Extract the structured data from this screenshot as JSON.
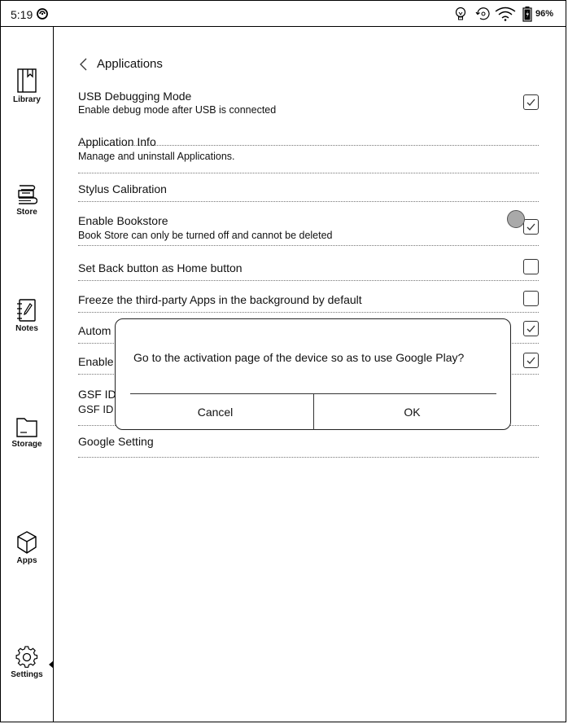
{
  "status": {
    "time": "5:19",
    "battery_percent": "96%"
  },
  "nav": {
    "library": "Library",
    "store": "Store",
    "notes": "Notes",
    "storage": "Storage",
    "apps": "Apps",
    "settings": "Settings"
  },
  "page": {
    "title": "Applications"
  },
  "rows": [
    {
      "title": "USB Debugging Mode",
      "subtitle": "Enable debug mode after USB is connected",
      "checked": true
    },
    {
      "title": "Application Info",
      "subtitle": "Manage and uninstall Applications."
    },
    {
      "title": "Stylus Calibration"
    },
    {
      "title": "Enable Bookstore",
      "subtitle": "Book Store can only be turned off and cannot be deleted",
      "checked": true
    },
    {
      "title": "Set Back button as Home button",
      "checked": false
    },
    {
      "title": "Freeze the third-party Apps in the background by default",
      "checked": false
    },
    {
      "title": "Autom",
      "checked": true
    },
    {
      "title": "Enable",
      "checked": true
    },
    {
      "title": "GSF ID",
      "subtitle": "GSF ID"
    },
    {
      "title": "Google Setting"
    }
  ],
  "dialog": {
    "message": "Go to the activation page of the device so as to use Google Play?",
    "cancel": "Cancel",
    "ok": "OK"
  }
}
